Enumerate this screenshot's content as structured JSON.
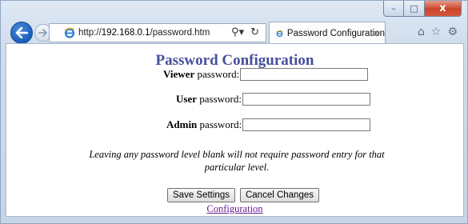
{
  "window": {
    "caption_buttons": {
      "minimize": "–",
      "maximize": "□",
      "close": "x"
    }
  },
  "browser": {
    "address_bar": {
      "url_prefix": "http://",
      "url_host": "192.168.0.1",
      "url_path": "/password.htm",
      "search_icon": "search-icon",
      "refresh_icon": "refresh-icon"
    },
    "tab": {
      "label": "Password Configuration",
      "close": "×"
    },
    "right_icons": [
      "home-icon",
      "favorites-star-icon",
      "settings-gear-icon"
    ]
  },
  "page": {
    "title": "Password Configuration",
    "fields": [
      {
        "bold": "Viewer",
        "suffix": " password:",
        "value": ""
      },
      {
        "bold": "User",
        "suffix": " password:",
        "value": ""
      },
      {
        "bold": "Admin",
        "suffix": " password:",
        "value": ""
      }
    ],
    "note": "Leaving any password level blank will not require password entry for that particular level.",
    "save_label": "Save Settings",
    "cancel_label": "Cancel Changes",
    "config_link": "Configuration"
  }
}
